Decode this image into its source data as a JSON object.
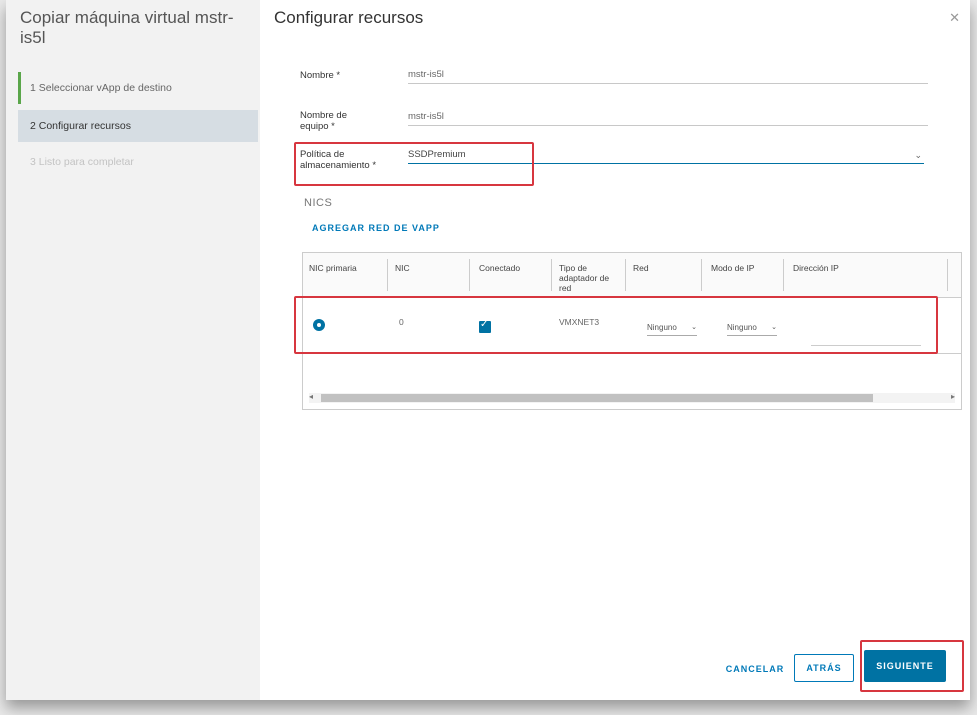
{
  "wizard": {
    "title": "Copiar máquina virtual mstr-is5l",
    "steps": [
      {
        "label": "1  Seleccionar vApp de destino"
      },
      {
        "label": "2  Configurar recursos"
      },
      {
        "label": "3  Listo para completar"
      }
    ]
  },
  "main": {
    "title": "Configurar recursos",
    "close_icon": "close-icon",
    "fields": {
      "name_label": "Nombre *",
      "name_value": "mstr-is5l",
      "computer_name_label": "Nombre de equipo *",
      "computer_name_value": "mstr-is5l",
      "storage_policy_label": "Política de almacenamiento *",
      "storage_policy_value": "SSDPremium"
    },
    "nics": {
      "title": "NICS",
      "add_label": "AGREGAR RED DE VAPP",
      "columns": [
        "NIC primaria",
        "NIC",
        "Conectado",
        "Tipo de adaptador de red",
        "Red",
        "Modo de IP",
        "Dirección IP"
      ],
      "row": {
        "nic": "0",
        "adapter": "VMXNET3",
        "network": "Ninguno",
        "ip_mode": "Ninguno",
        "primary": true,
        "connected": true
      }
    }
  },
  "buttons": {
    "cancel": "CANCELAR",
    "back": "ATRÁS",
    "next": "SIGUIENTE"
  },
  "colors": {
    "accent": "#0072a3",
    "highlight": "#d7363f",
    "step_done": "#5aa64a"
  }
}
